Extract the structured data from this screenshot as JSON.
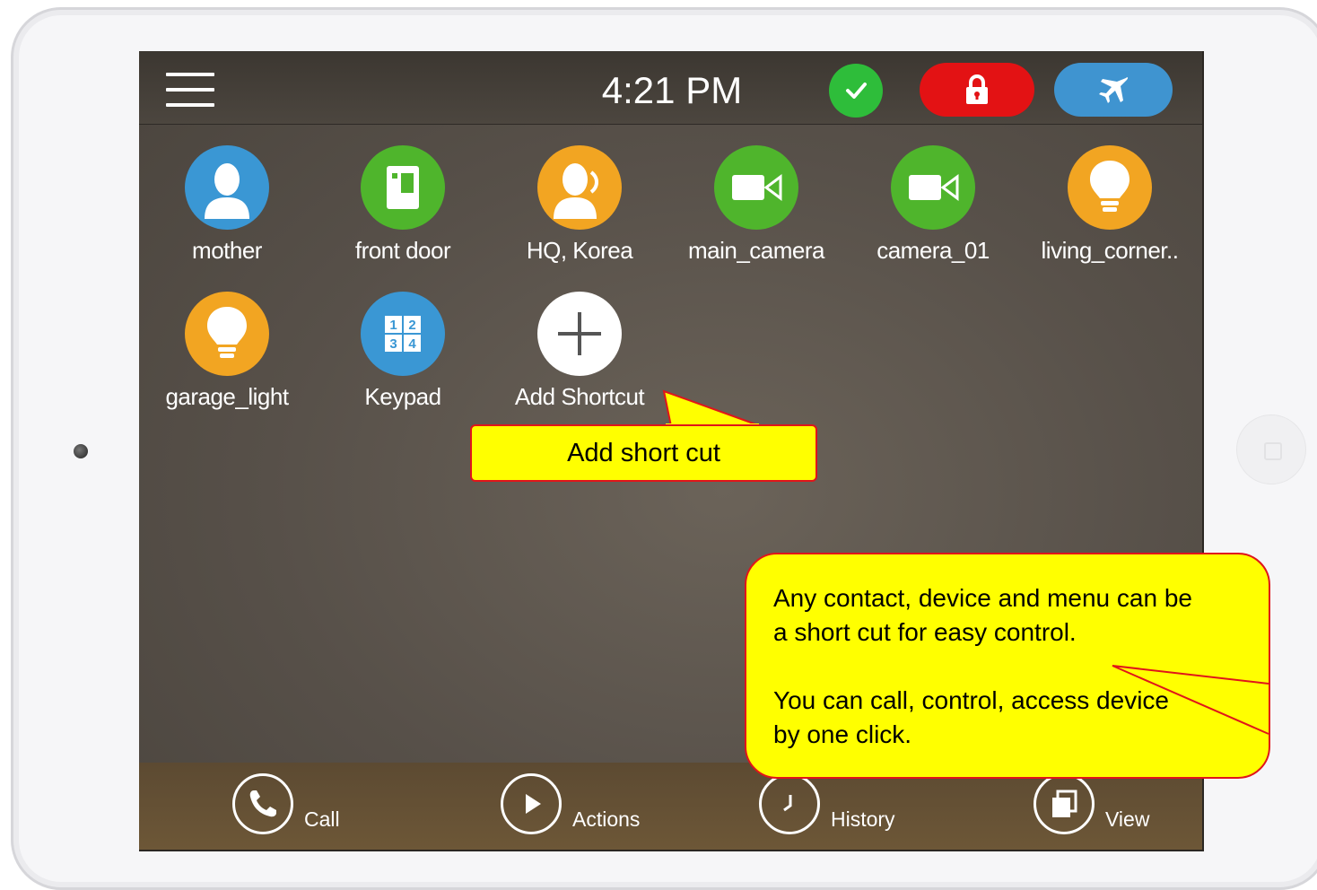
{
  "status_bar": {
    "time": "4:21 PM",
    "status_icon": "check-icon",
    "lock_icon": "lock-icon",
    "mode_icon": "airplane-icon",
    "colors": {
      "ok": "#2ebd3a",
      "lock": "#e31214",
      "mode": "#3f94d0"
    }
  },
  "shortcuts": [
    {
      "label": "mother",
      "icon": "person-icon",
      "color": "#3a97d4"
    },
    {
      "label": "front door",
      "icon": "door-icon",
      "color": "#4fb52c"
    },
    {
      "label": "HQ, Korea",
      "icon": "person-calling-icon",
      "color": "#f2a522"
    },
    {
      "label": "main_camera",
      "icon": "video-camera-icon",
      "color": "#4fb52c"
    },
    {
      "label": "camera_01",
      "icon": "video-camera-icon",
      "color": "#4fb52c"
    },
    {
      "label": "living_corner..",
      "icon": "lightbulb-icon",
      "color": "#f2a522"
    },
    {
      "label": "garage_light",
      "icon": "lightbulb-icon",
      "color": "#f2a522"
    },
    {
      "label": "Keypad",
      "icon": "keypad-icon",
      "color": "#3a97d4",
      "keys": [
        "1",
        "2",
        "3",
        "4"
      ]
    },
    {
      "label": "Add Shortcut",
      "icon": "plus-icon",
      "color": "#ffffff"
    }
  ],
  "bottom_nav": [
    {
      "label": "Call",
      "icon": "phone-icon"
    },
    {
      "label": "Actions",
      "icon": "play-icon"
    },
    {
      "label": "History",
      "icon": "clock-icon"
    },
    {
      "label": "View",
      "icon": "view-icon"
    }
  ],
  "callouts": {
    "add": "Add short cut",
    "info_line1": "Any contact, device and menu can be",
    "info_line2": "a short cut for easy control.",
    "info_line3": "You can call, control, access device",
    "info_line4": "by one click."
  }
}
